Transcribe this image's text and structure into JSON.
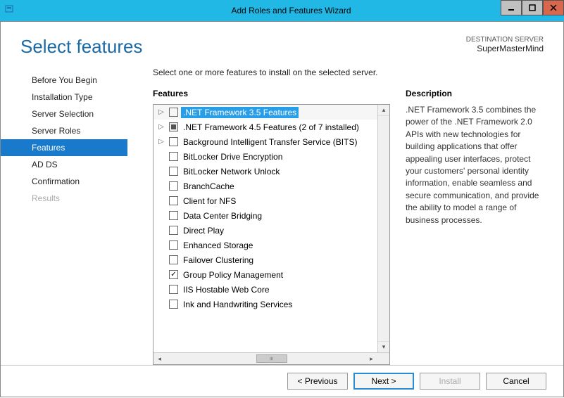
{
  "window": {
    "title": "Add Roles and Features Wizard"
  },
  "header": {
    "title": "Select features",
    "dest_label": "DESTINATION SERVER",
    "dest_name": "SuperMasterMind"
  },
  "sidebar": {
    "items": [
      {
        "label": "Before You Begin",
        "active": false,
        "disabled": false
      },
      {
        "label": "Installation Type",
        "active": false,
        "disabled": false
      },
      {
        "label": "Server Selection",
        "active": false,
        "disabled": false
      },
      {
        "label": "Server Roles",
        "active": false,
        "disabled": false
      },
      {
        "label": "Features",
        "active": true,
        "disabled": false
      },
      {
        "label": "AD DS",
        "active": false,
        "disabled": false
      },
      {
        "label": "Confirmation",
        "active": false,
        "disabled": false
      },
      {
        "label": "Results",
        "active": false,
        "disabled": true
      }
    ]
  },
  "main": {
    "instruction": "Select one or more features to install on the selected server.",
    "features_heading": "Features",
    "description_heading": "Description",
    "description_text": ".NET Framework 3.5 combines the power of the .NET Framework 2.0 APIs with new technologies for building applications that offer appealing user interfaces, protect your customers' personal identity information, enable seamless and secure communication, and provide the ability to model a range of business processes.",
    "features": [
      {
        "label": ".NET Framework 3.5 Features",
        "expandable": true,
        "state": "unchecked",
        "selected": true
      },
      {
        "label": ".NET Framework 4.5 Features (2 of 7 installed)",
        "expandable": true,
        "state": "partial",
        "selected": false
      },
      {
        "label": "Background Intelligent Transfer Service (BITS)",
        "expandable": true,
        "state": "unchecked",
        "selected": false
      },
      {
        "label": "BitLocker Drive Encryption",
        "expandable": false,
        "state": "unchecked",
        "selected": false
      },
      {
        "label": "BitLocker Network Unlock",
        "expandable": false,
        "state": "unchecked",
        "selected": false
      },
      {
        "label": "BranchCache",
        "expandable": false,
        "state": "unchecked",
        "selected": false
      },
      {
        "label": "Client for NFS",
        "expandable": false,
        "state": "unchecked",
        "selected": false
      },
      {
        "label": "Data Center Bridging",
        "expandable": false,
        "state": "unchecked",
        "selected": false
      },
      {
        "label": "Direct Play",
        "expandable": false,
        "state": "unchecked",
        "selected": false
      },
      {
        "label": "Enhanced Storage",
        "expandable": false,
        "state": "unchecked",
        "selected": false
      },
      {
        "label": "Failover Clustering",
        "expandable": false,
        "state": "unchecked",
        "selected": false
      },
      {
        "label": "Group Policy Management",
        "expandable": false,
        "state": "checked",
        "selected": false
      },
      {
        "label": "IIS Hostable Web Core",
        "expandable": false,
        "state": "unchecked",
        "selected": false
      },
      {
        "label": "Ink and Handwriting Services",
        "expandable": false,
        "state": "unchecked",
        "selected": false
      }
    ]
  },
  "footer": {
    "previous": "< Previous",
    "next": "Next >",
    "install": "Install",
    "cancel": "Cancel"
  }
}
